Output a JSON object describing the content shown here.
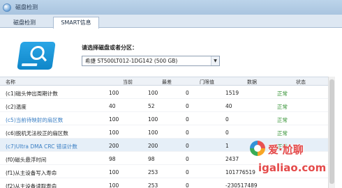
{
  "window": {
    "title": "磁盘检测"
  },
  "tabs": [
    {
      "label": "磁盘检测"
    },
    {
      "label": "SMART信息"
    }
  ],
  "select": {
    "label": "请选择磁盘或者分区：",
    "value": "希捷 ST500LT012-1DG142  (500 GB)"
  },
  "table": {
    "headers": {
      "name": "名称",
      "current": "当前",
      "worst": "最差",
      "threshold": "门限值",
      "data": "数据",
      "status": "状态"
    },
    "rows": [
      {
        "name": "(c1)磁头伸出周期计数",
        "current": "100",
        "worst": "100",
        "threshold": "0",
        "data": "1519",
        "status": "正常"
      },
      {
        "name": "(c2)温度",
        "current": "40",
        "worst": "52",
        "threshold": "0",
        "data": "40",
        "status": "正常"
      },
      {
        "name": "(c5)当前待映射的扇区数",
        "current": "100",
        "worst": "100",
        "threshold": "0",
        "data": "0",
        "status": "正常"
      },
      {
        "name": "(c6)脱机无法校正的扇区数",
        "current": "100",
        "worst": "100",
        "threshold": "0",
        "data": "0",
        "status": "正常"
      },
      {
        "name": "(c7)Ultra DMA CRC 错误计数",
        "current": "200",
        "worst": "200",
        "threshold": "0",
        "data": "1",
        "status": "正常"
      },
      {
        "name": "(f0)磁头悬浮时间",
        "current": "98",
        "worst": "98",
        "threshold": "0",
        "data": "2437",
        "status": ""
      },
      {
        "name": "(f1)从主设备写入寿命",
        "current": "100",
        "worst": "253",
        "threshold": "0",
        "data": "101776519",
        "status": ""
      },
      {
        "name": "(f2)从主设备读取寿命",
        "current": "100",
        "worst": "253",
        "threshold": "0",
        "data": "-230517489",
        "status": ""
      }
    ]
  },
  "watermark": {
    "brand": "爱·尬聊",
    "url": "igaliao.com"
  },
  "colors": {
    "titlebar": "#a9c4df",
    "ok_status": "#2f8f2f",
    "highlight_name": "#3b7fc4",
    "watermark": "#e44a4a",
    "disk_icon": "#1a97d8"
  }
}
